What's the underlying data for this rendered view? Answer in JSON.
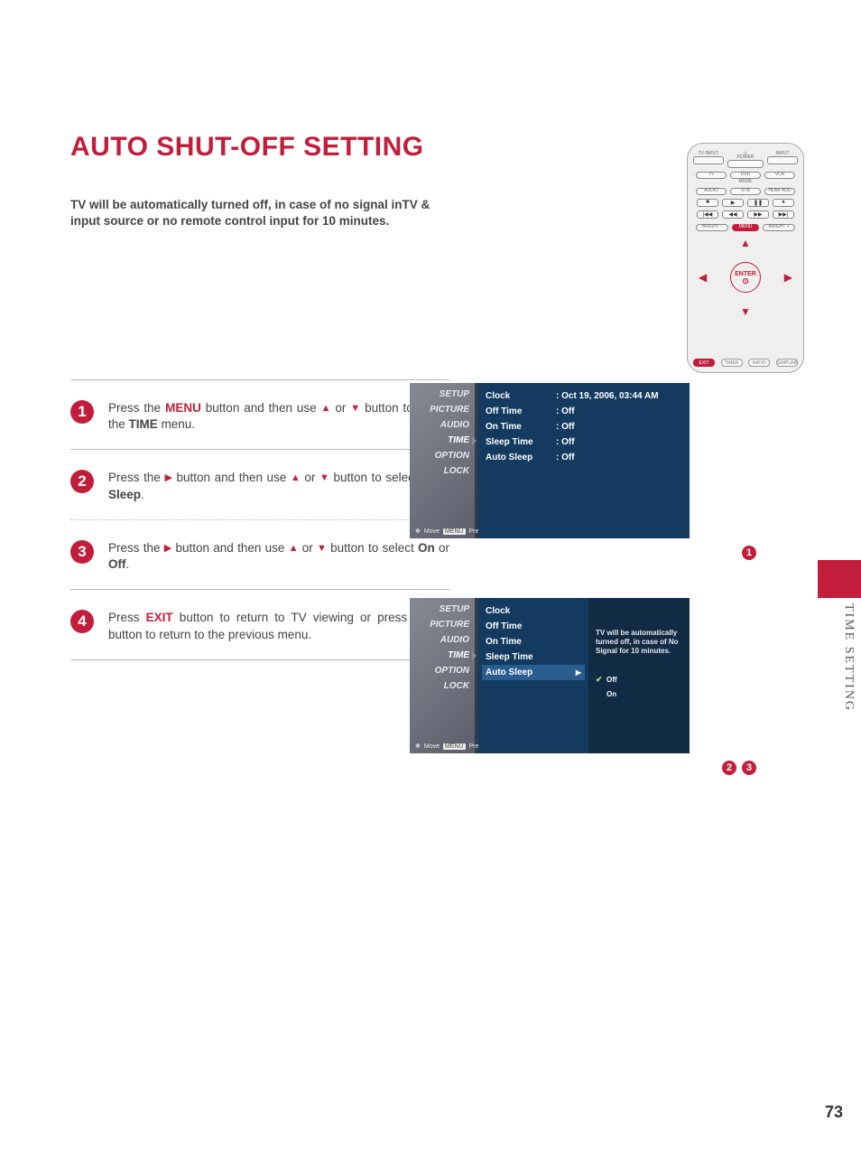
{
  "page_title": "AUTO SHUT-OFF SETTING",
  "intro": "TV will be automatically turned off, in case of no signal inTV & input source or no remote control input for 10 minutes.",
  "side_tab": "TIME SETTING",
  "page_number": "73",
  "remote": {
    "labels": {
      "tv_input": "TV INPUT",
      "power": "POWER",
      "input": "INPUT",
      "tv": "TV",
      "dvd": "DVD",
      "vcr": "VCR",
      "mode": "MODE",
      "audio": "AUDIO",
      "stb": "STB",
      "hdmihdd": "HDMI HDD",
      "bright_minus": "BRIGHT -",
      "menu": "MENU",
      "bright_plus": "BRIGHT +",
      "enter": "ENTER",
      "exit": "EXIT",
      "timer": "TIMER",
      "ratio": "RATIO",
      "simplink": "SIMPLINK"
    }
  },
  "steps": [
    {
      "n": "1",
      "html": "Press the <span class='kw-menu'>MENU</span> button and then use <span class='tri'>▲</span> or <span class='tri'>▼</span> button to select the <b>TIME</b> menu."
    },
    {
      "n": "2",
      "html": "Press the <span class='tri'>▶</span> button and then use <span class='tri'>▲</span> or <span class='tri'>▼</span> button to select <b>Auto Sleep</b>."
    },
    {
      "n": "3",
      "html": "Press the <span class='tri'>▶</span> button and then use <span class='tri'>▲</span> or <span class='tri'>▼</span> button to select <b>On</b> or <b>Off</b>."
    },
    {
      "n": "4",
      "html": "Press <span class='kw-exit'>EXIT</span> button to return to TV viewing or press <span class='kw-menu'>MENU</span> button to return to the previous menu."
    }
  ],
  "osd1": {
    "sidebar": [
      "SETUP",
      "PICTURE",
      "AUDIO",
      "TIME",
      "OPTION",
      "LOCK"
    ],
    "selected_sidebar_index": 3,
    "footer_move": "Move",
    "footer_menu": "MENU",
    "footer_prev": "Prev",
    "rows": [
      {
        "k": "Clock",
        "v": ": Oct 19, 2006, 03:44 AM"
      },
      {
        "k": "Off Time",
        "v": ": Off"
      },
      {
        "k": "On Time",
        "v": ": Off"
      },
      {
        "k": "Sleep Time",
        "v": ": Off"
      },
      {
        "k": "Auto Sleep",
        "v": ": Off"
      }
    ]
  },
  "osd2": {
    "sidebar": [
      "SETUP",
      "PICTURE",
      "AUDIO",
      "TIME",
      "OPTION",
      "LOCK"
    ],
    "selected_sidebar_index": 3,
    "footer_move": "Move",
    "footer_menu": "MENU",
    "footer_prev": "Prev",
    "rows": [
      {
        "k": "Clock"
      },
      {
        "k": "Off Time"
      },
      {
        "k": "On Time"
      },
      {
        "k": "Sleep Time"
      },
      {
        "k": "Auto Sleep",
        "selected": true
      }
    ],
    "right": {
      "desc": "TV will be automatically turned off, in case of No Signal for 10 minutes.",
      "options": [
        {
          "label": "Off",
          "checked": true
        },
        {
          "label": "On",
          "checked": false
        }
      ]
    }
  },
  "ref1": [
    "1"
  ],
  "ref23": [
    "2",
    "3"
  ]
}
